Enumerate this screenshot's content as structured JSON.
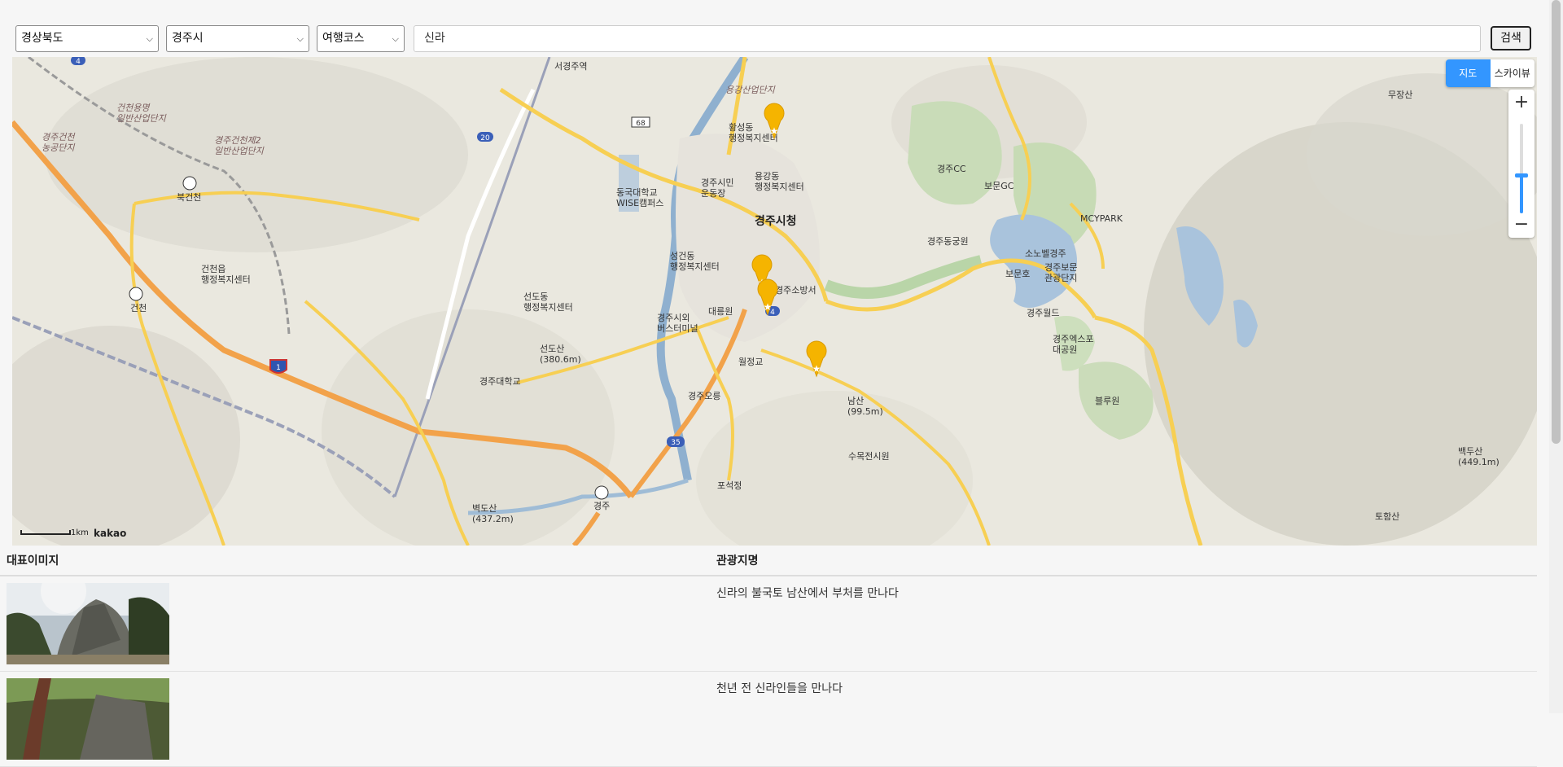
{
  "filters": {
    "province": "경상북도",
    "city": "경주시",
    "category": "여행코스"
  },
  "search": {
    "value": "신라",
    "button": "검색"
  },
  "map": {
    "type_buttons": [
      "지도",
      "스카이뷰"
    ],
    "zoom_in": "+",
    "zoom_out": "−",
    "scale_label": "1km",
    "logo": "kakao",
    "labels": {
      "seogyeongju": "서경주역",
      "hwangseong": "황성동\n행정복지센터",
      "yonggang": "용강동\n행정복지센터",
      "stadium": "경주시민\n운동장",
      "dongguk": "동국대학교\nWISE캠퍼스",
      "cityhall": "경주시청",
      "seonggeon": "성건동\n행정복지센터",
      "seondo": "선도동\n행정복지센터",
      "bus": "경주시외\n버스터미널",
      "daereungwon": "대릉원",
      "fire": "경주소방서",
      "woljeonggyo": "월정교",
      "seondosan": "선도산\n(380.6m)",
      "gju_univ": "경주대학교",
      "gyeongju_orung": "경주오릉",
      "namsan": "남산\n(99.5m)",
      "sumok": "수목전시원",
      "poseokjeong": "포석정",
      "byeokdosan": "벽도산\n(437.2m)",
      "geoncheon_eup": "건천읍\n행정복지센터",
      "bukgeoncheon": "북건천",
      "geoncheon": "건천",
      "gyeongju_ic": "경주",
      "gyeongju_cc": "경주CC",
      "bomun_gc": "보문GC",
      "mcypark": "MCYPARK",
      "dongpark": "경주동궁원",
      "sonobel": "소노벨경주",
      "bomunho": "보문호",
      "bomun_complex": "경주보문\n관광단지",
      "gyeongju_world": "경주월드",
      "expo": "경주엑스포\n대공원",
      "bluone": "블루원",
      "baekdusan": "백두산\n(449.1m)",
      "tohamsan": "토함산",
      "mujangsan": "무장산",
      "ind_complex": "건천용명\n일반산업단지",
      "ind_complex2": "경주건천제2\n일반산업단지",
      "ind_complex3": "경주건천\n농공단지",
      "yongsan_ind": "용강산업단지"
    },
    "road_numbers": [
      "4",
      "20",
      "68",
      "35",
      "4",
      "1"
    ],
    "accent": "#3396ff",
    "marker_color": "#f5b400"
  },
  "table": {
    "headers": [
      "대표이미지",
      "관광지명"
    ],
    "rows": [
      {
        "title": "신라의 불국토 남산에서 부처를 만나다"
      },
      {
        "title": "천년 전 신라인들을 만나다"
      }
    ]
  }
}
